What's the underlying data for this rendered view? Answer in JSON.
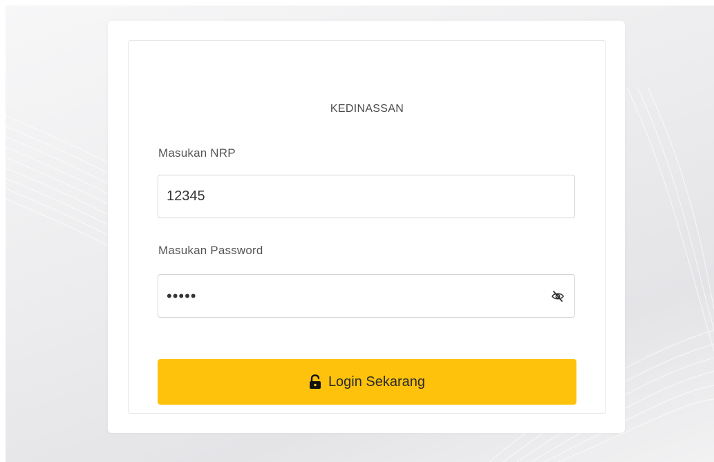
{
  "form": {
    "heading": "KEDINASSAN",
    "nrp_label": "Masukan NRP",
    "nrp_value": "12345",
    "password_label": "Masukan Password",
    "password_value": "12345",
    "login_label": "Login Sekarang"
  },
  "icons": {
    "password_toggle": "eye-slash-icon",
    "login": "unlock-icon"
  },
  "colors": {
    "accent": "#fec20d",
    "background": "#ececee"
  }
}
